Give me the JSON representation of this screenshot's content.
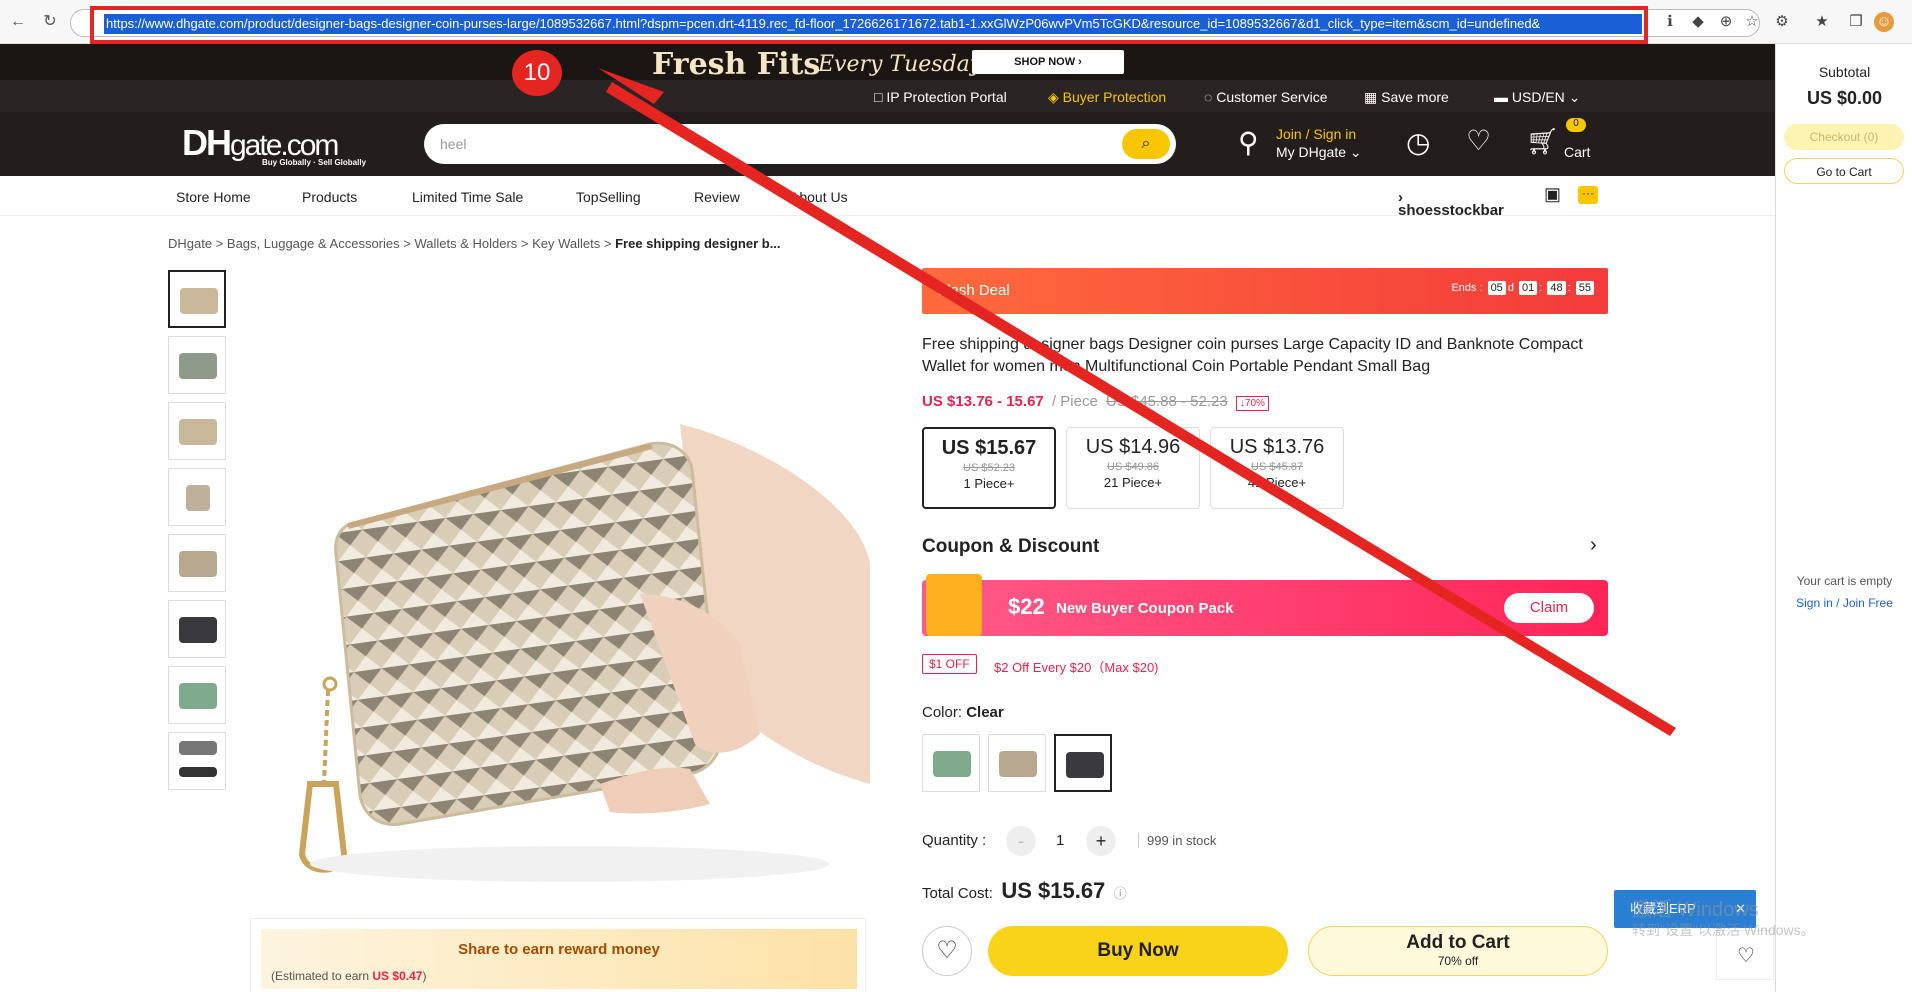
{
  "browser": {
    "url": "https://www.dhgate.com/product/designer-bags-designer-coin-purses-large/1089532667.html?dspm=pcen.drt-4119.rec_fd-floor_1726626171672.tab1-1.xxGlWzP06wvPVm5TcGKD&resource_id=1089532667&d1_click_type=item&scm_id=undefined&",
    "step_badge": "10"
  },
  "promo": {
    "fresh": "Fresh Fits",
    "every": "Every Tuesday",
    "shop": "SHOP NOW ›"
  },
  "util": {
    "ip": "IP Protection Portal",
    "buyer": "Buyer Protection",
    "service": "Customer Service",
    "save": "Save more",
    "currency": "USD/EN"
  },
  "header": {
    "logo_dh": "DH",
    "logo_gate": "gate.com",
    "logo_tag": "Buy Globally · Sell Globally",
    "search_value": "heel",
    "join": "Join / Sign in",
    "my": "My DHgate",
    "cart": "Cart",
    "cart_count": "0"
  },
  "tabs": [
    "Store Home",
    "Products",
    "Limited Time Sale",
    "TopSelling",
    "Review",
    "About Us"
  ],
  "store_name": "shoesstockbar",
  "breadcrumb": {
    "p1": "DHgate",
    "p2": "Bags, Luggage & Accessories",
    "p3": "Wallets & Holders",
    "p4": "Key Wallets",
    "current": "Free shipping designer b..."
  },
  "flash": {
    "label": "Flash Deal",
    "ends": "Ends :",
    "d": "05",
    "dl": "d",
    "h": "01",
    "m": "48",
    "s": "55"
  },
  "product": {
    "title": "Free shipping designer bags Designer coin purses Large Capacity ID and Banknote Compact Wallet for women men Multifunctional Coin Portable Pendant Small Bag",
    "price_range": "US $13.76 - 15.67",
    "per": "/ Piece",
    "orig_range": "US $45.88 - 52.23",
    "discount": "↓70%"
  },
  "tiers": [
    {
      "price": "US $15.67",
      "orig": "US $52.23",
      "qty": "1 Piece+"
    },
    {
      "price": "US $14.96",
      "orig": "US $49.86",
      "qty": "21 Piece+"
    },
    {
      "price": "US $13.76",
      "orig": "US $45.87",
      "qty": "41 Piece+"
    }
  ],
  "coupon": {
    "title": "Coupon & Discount",
    "amount": "$22",
    "pack": "New Buyer Coupon Pack",
    "claim": "Claim",
    "off": "$1 OFF",
    "rule": "$2 Off Every $20（Max $20)"
  },
  "color": {
    "label": "Color:",
    "value": "Clear"
  },
  "quantity": {
    "label": "Quantity :",
    "minus": "-",
    "value": "1",
    "plus": "+",
    "stock": "999 in stock"
  },
  "total": {
    "label": "Total Cost:",
    "value": "US $15.67"
  },
  "actions": {
    "buy": "Buy Now",
    "add": "Add to Cart",
    "add_sub": "70% off"
  },
  "share": {
    "title": "Share to earn reward money",
    "est": "(Estimated to earn",
    "amt": "US $0.47",
    "close": ")"
  },
  "sidebar": {
    "subtotal": "Subtotal",
    "amount": "US $0.00",
    "checkout": "Checkout (0)",
    "goto": "Go to Cart",
    "empty": "Your cart is empty",
    "signin": "Sign in",
    "slash": "/",
    "join": "Join Free"
  },
  "erp": {
    "label": "收藏到ERP",
    "close": "✕"
  },
  "watermark": {
    "line1": "激活 Windows",
    "line2": "转到\"设置\"以激活 Windows。"
  }
}
